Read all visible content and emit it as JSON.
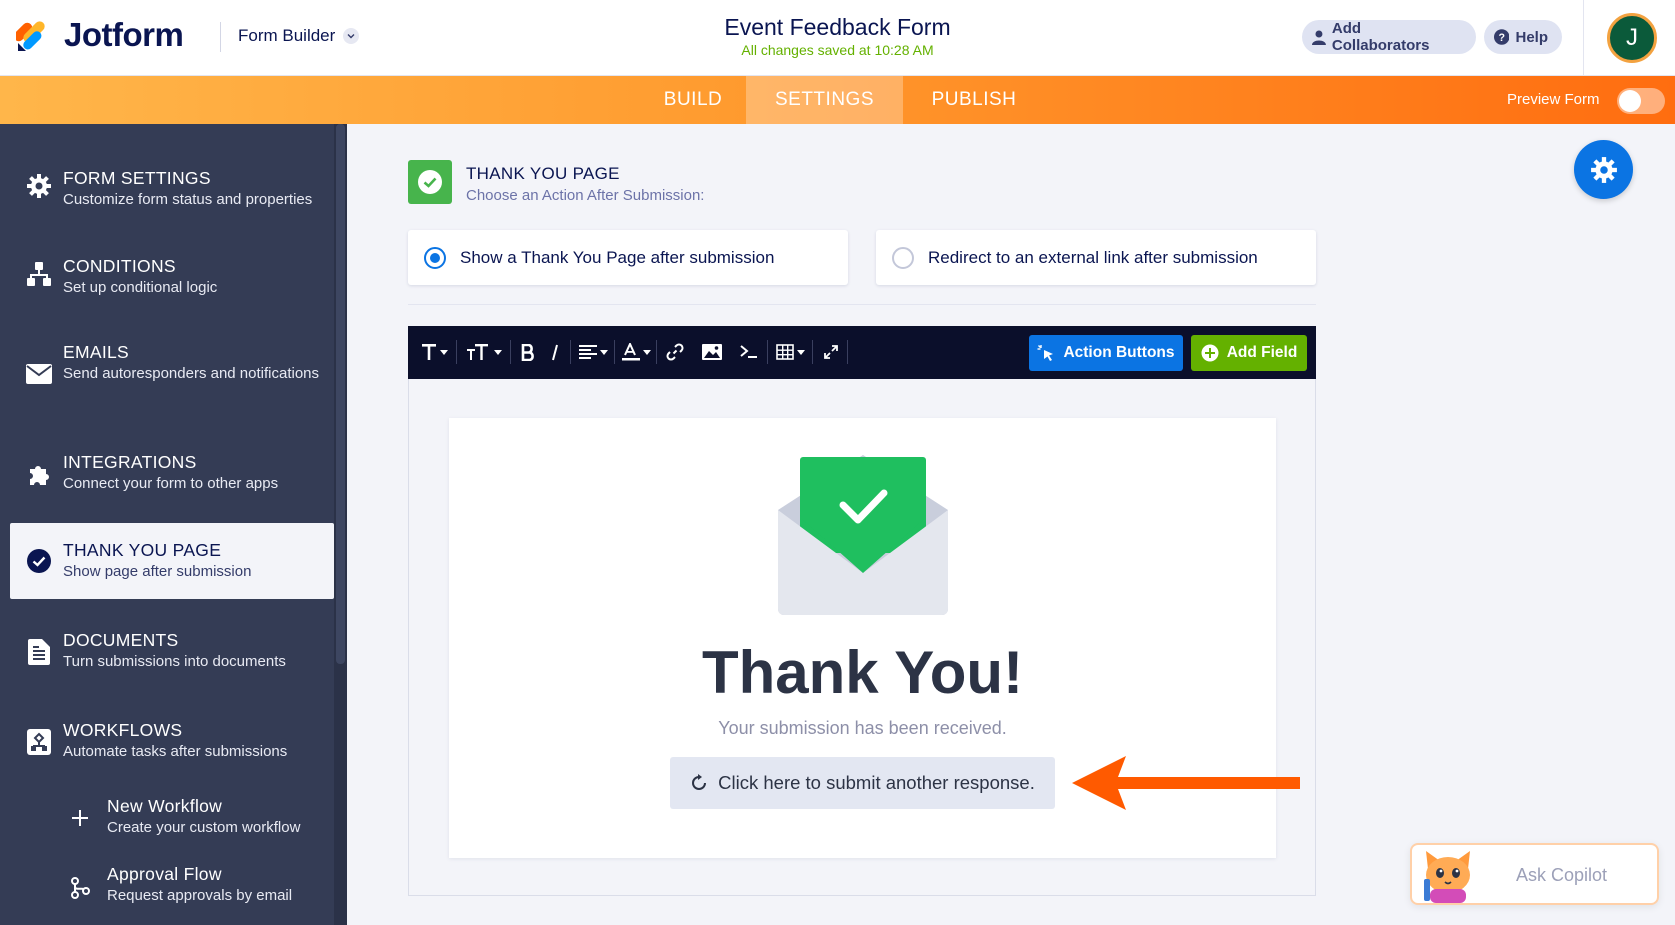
{
  "header": {
    "logo_text": "Jotform",
    "builder_menu": "Form Builder",
    "form_title": "Event Feedback Form",
    "save_status": "All changes saved at 10:28 AM",
    "collaborators_label": "Add Collaborators",
    "help_label": "Help",
    "avatar_initial": "J"
  },
  "nav": {
    "tabs": [
      {
        "label": "BUILD",
        "active": false
      },
      {
        "label": "SETTINGS",
        "active": true
      },
      {
        "label": "PUBLISH",
        "active": false
      }
    ],
    "preview_label": "Preview Form"
  },
  "sidebar": {
    "items": [
      {
        "title": "FORM SETTINGS",
        "subtitle": "Customize form status and properties",
        "icon": "gear-icon"
      },
      {
        "title": "CONDITIONS",
        "subtitle": "Set up conditional logic",
        "icon": "conditions-icon"
      },
      {
        "title": "EMAILS",
        "subtitle": "Send autoresponders and notifications",
        "icon": "envelope-icon"
      },
      {
        "title": "INTEGRATIONS",
        "subtitle": "Connect your form to other apps",
        "icon": "puzzle-icon"
      },
      {
        "title": "THANK YOU PAGE",
        "subtitle": "Show page after submission",
        "icon": "check-circle-icon",
        "active": true
      },
      {
        "title": "DOCUMENTS",
        "subtitle": "Turn submissions into documents",
        "icon": "document-icon"
      },
      {
        "title": "WORKFLOWS",
        "subtitle": "Automate tasks after submissions",
        "icon": "workflow-icon"
      }
    ],
    "sub_items": [
      {
        "title": "New Workflow",
        "subtitle": "Create your custom workflow",
        "icon": "plus-icon"
      },
      {
        "title": "Approval Flow",
        "subtitle": "Request approvals by email",
        "icon": "flow-icon"
      }
    ]
  },
  "main": {
    "section_title": "THANK YOU PAGE",
    "section_subtitle": "Choose an Action After Submission:",
    "options": [
      {
        "label": "Show a Thank You Page after submission",
        "selected": true
      },
      {
        "label": "Redirect to an external link after submission",
        "selected": false
      }
    ],
    "toolbar": {
      "action_buttons_label": "Action Buttons",
      "add_field_label": "Add Field"
    },
    "preview": {
      "heading": "Thank You!",
      "message": "Your submission has been received.",
      "another_response_label": "Click here to submit another response."
    },
    "copilot_label": "Ask Copilot"
  },
  "colors": {
    "accent_blue": "#0b74e3",
    "accent_green": "#64b100",
    "sidebar_bg": "#343c55",
    "annotation_arrow": "#ff5a00"
  }
}
